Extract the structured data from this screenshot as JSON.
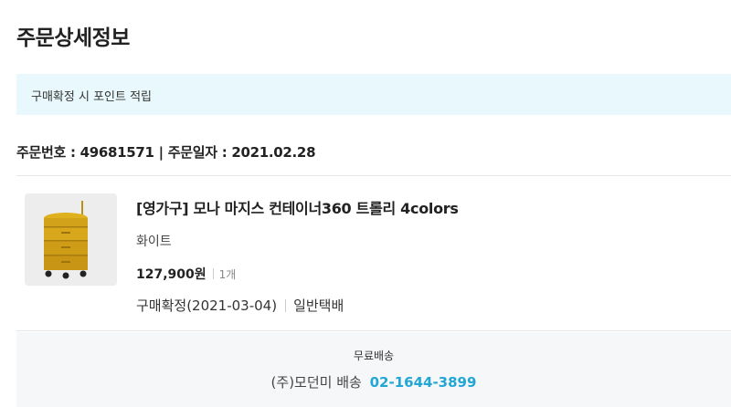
{
  "page": {
    "title": "주문상세정보"
  },
  "notice": {
    "text": "구매확정 시 포인트 적립"
  },
  "order": {
    "number_label": "주문번호",
    "number": "49681571",
    "date_label": "주문일자",
    "date": "2021.02.28"
  },
  "product": {
    "name": "[영가구] 모나 마지스 컨테이너360 트롤리 4colors",
    "option": "화이트",
    "price": "127,900원",
    "quantity": "1개",
    "status": "구매확정(2021-03-04)",
    "delivery_type": "일반택배",
    "image_icon": "yellow-trolley-image"
  },
  "shipping": {
    "fee_label": "무료배송",
    "courier": "(주)모던미 배송",
    "phone": "02-1644-3899"
  },
  "colors": {
    "notice_bg": "#e8f8fc",
    "accent_phone": "#22a6d6",
    "shipping_bg": "#f5f7f8"
  }
}
